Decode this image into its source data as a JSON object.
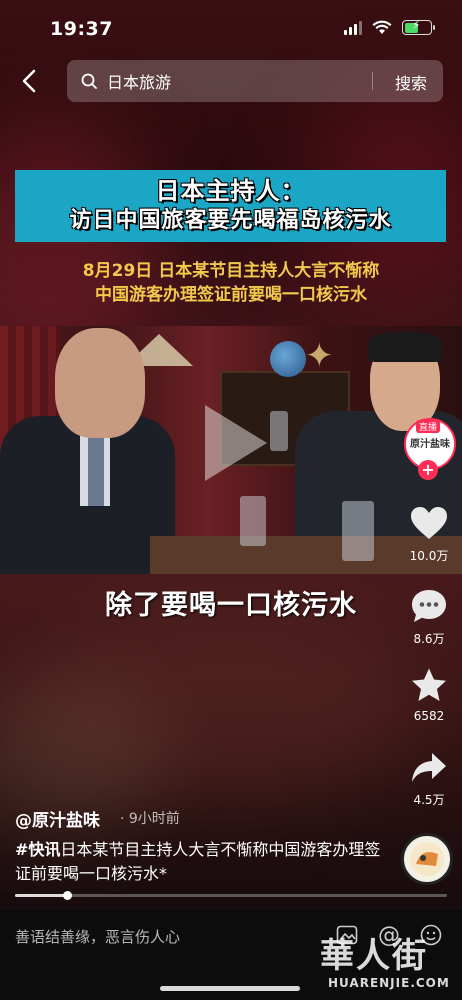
{
  "status_bar": {
    "time": "19:37",
    "battery_level": 0.55
  },
  "search": {
    "query": "日本旅游",
    "submit_label": "搜索"
  },
  "headline": {
    "line1": "日本主持人：",
    "line2": "访日中国旅客要先喝福岛核污水"
  },
  "subtitle": {
    "line1": "8月29日 日本某节目主持人大言不惭称",
    "line2": "中国游客办理签证前要喝一口核污水"
  },
  "video": {
    "caption": "除了要喝一口核污水"
  },
  "right_rail": {
    "live_tag": "直播",
    "live_avatar_text": "原汁盐味",
    "likes": "10.0万",
    "comments": "8.6万",
    "favorites": "6582",
    "shares": "4.5万"
  },
  "author": {
    "name": "@原汁盐味",
    "time_ago": "· 9小时前"
  },
  "description": {
    "tag": "#快讯",
    "text": "日本某节目主持人大言不惭称中国游客办理签证前要喝一口核污水*"
  },
  "progress": {
    "fraction": 0.12
  },
  "comment_bar": {
    "placeholder": "善语结善缘，恶言伤人心"
  },
  "watermark": {
    "cn": "華人街",
    "en": "HUARENJIE.COM"
  },
  "colors": {
    "banner": "#1aa6c4",
    "subtitle": "#f2c94c",
    "accent": "#ff2d55"
  }
}
